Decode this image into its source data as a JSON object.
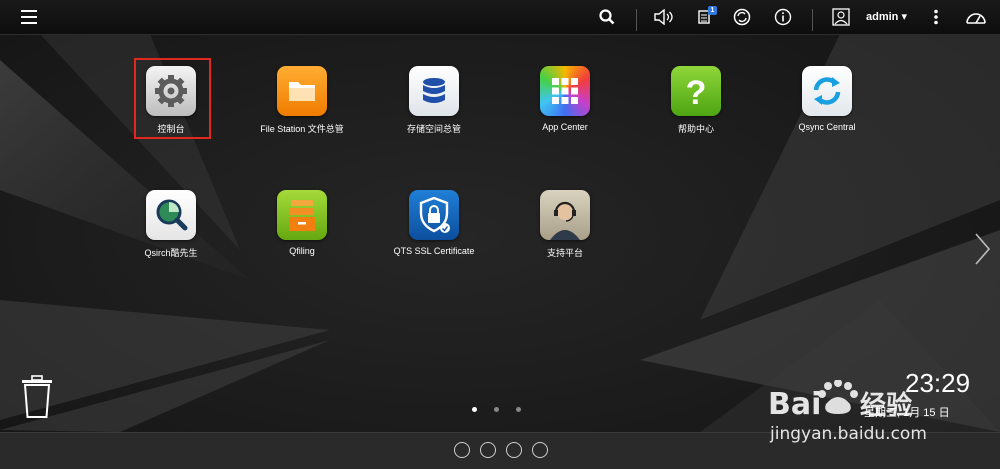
{
  "topbar": {
    "user": "admin ▾",
    "notification_count": "1"
  },
  "apps": [
    {
      "label": "控制台",
      "icon": "gear-icon"
    },
    {
      "label": "File Station 文件总管",
      "icon": "folder-icon"
    },
    {
      "label": "存储空间总管",
      "icon": "database-icon"
    },
    {
      "label": "App Center",
      "icon": "app-grid-icon"
    },
    {
      "label": "帮助中心",
      "icon": "help-icon"
    },
    {
      "label": "Qsync Central",
      "icon": "sync-icon"
    },
    {
      "label": "Qsirch酷先生",
      "icon": "search-magnifier-icon"
    },
    {
      "label": "Qfiling",
      "icon": "file-drawer-icon"
    },
    {
      "label": "QTS SSL Certificate",
      "icon": "shield-lock-icon"
    },
    {
      "label": "支持平台",
      "icon": "support-agent-icon"
    }
  ],
  "clock": {
    "time": "23:29",
    "date": "星期三, 1月 15 日"
  },
  "page_indicator": {
    "total": 3,
    "current": 1
  },
  "watermark": {
    "logo": "Bai 经验",
    "url": "jingyan.baidu.com"
  },
  "colors": {
    "highlight": "#e0281f",
    "accent_blue": "#2f78e0"
  }
}
